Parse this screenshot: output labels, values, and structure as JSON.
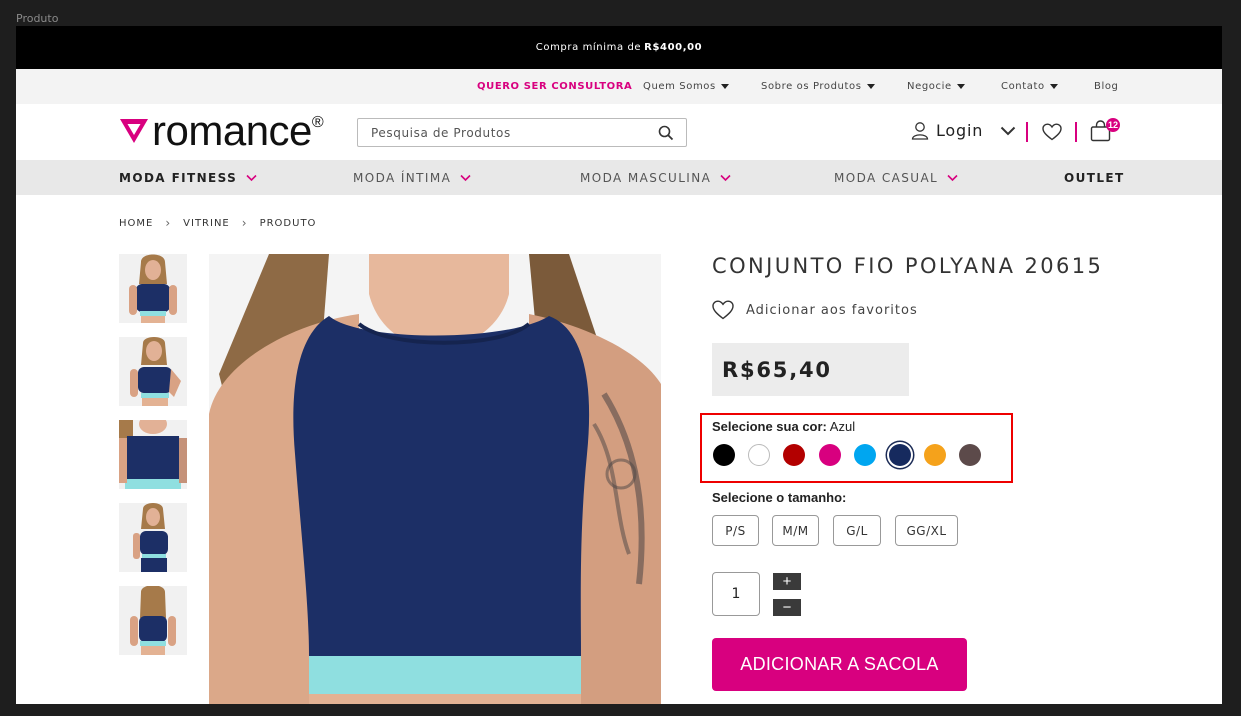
{
  "window": {
    "frame_label": "Produto"
  },
  "topbar": {
    "text": "Compra mínima de",
    "amount": "R$400,00"
  },
  "utility_nav": {
    "consultora": "QUERO SER CONSULTORA",
    "quem_somos": "Quem Somos",
    "sobre": "Sobre os Produtos",
    "negocie": "Negocie",
    "contato": "Contato",
    "blog": "Blog"
  },
  "header": {
    "logo_text": "romance",
    "logo_reg": "®",
    "search_placeholder": "Pesquisa de Produtos",
    "login_label": "Login",
    "cart_count": "12"
  },
  "category_nav": {
    "fitness": "MODA FITNESS",
    "intima": "MODA ÍNTIMA",
    "masculina": "MODA MASCULINA",
    "casual": "MODA CASUAL",
    "outlet": "OUTLET"
  },
  "breadcrumb": {
    "home": "HOME",
    "vitrine": "VITRINE",
    "produto": "PRODUTO"
  },
  "product": {
    "title": "CONJUNTO FIO POLYANA 20615",
    "favorite_label": "Adicionar aos favoritos",
    "price": "R$65,40",
    "color_label": "Selecione sua cor:",
    "selected_color": "Azul",
    "colors": [
      "#000000",
      "#ffffff",
      "#b30000",
      "#d8007f",
      "#00a6f0",
      "#162a5e",
      "#f5a21b",
      "#5c4a4a"
    ],
    "size_label": "Selecione o tamanho:",
    "sizes": [
      "P/S",
      "M/M",
      "G/L",
      "GG/XL"
    ],
    "quantity": "1",
    "plus": "+",
    "minus": "−",
    "add_button": "ADICIONAR A SACOLA"
  },
  "theme": {
    "accent": "#d8007f",
    "highlight_border": "#e00000",
    "price_bg": "#ececec"
  }
}
